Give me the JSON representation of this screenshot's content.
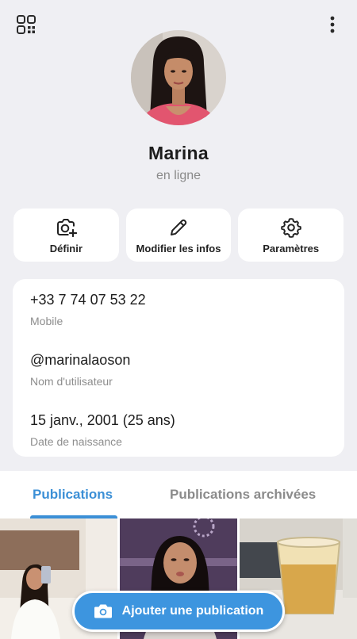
{
  "profile": {
    "name": "Marina",
    "status": "en ligne"
  },
  "actions": {
    "set_photo": "Définir",
    "edit_info": "Modifier les infos",
    "settings": "Paramètres"
  },
  "info": {
    "phone_value": "+33 7 74 07 53 22",
    "phone_label": "Mobile",
    "username_value": "@marinalaoson",
    "username_label": "Nom d'utilisateur",
    "birthday_value": "15 janv., 2001 (25 ans)",
    "birthday_label": "Date de naissance"
  },
  "tabs": {
    "posts": "Publications",
    "archived": "Publications archivées"
  },
  "fab": {
    "label": "Ajouter une publication"
  },
  "colors": {
    "accent": "#3b8fd6",
    "background": "#efeff3"
  },
  "icons": [
    "qr-code-icon",
    "more-vertical-icon",
    "camera-add-icon",
    "pencil-icon",
    "gear-icon",
    "camera-icon"
  ]
}
